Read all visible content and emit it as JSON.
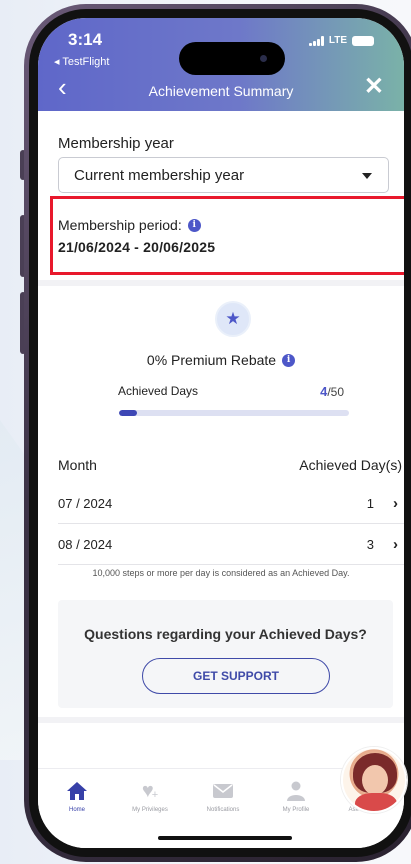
{
  "status_bar": {
    "time": "3:14",
    "back_app": "◂ TestFlight",
    "network": "LTE"
  },
  "nav": {
    "title": "Achievement Summary",
    "back": "‹",
    "close": "✕"
  },
  "membership": {
    "year_label": "Membership year",
    "year_selected": "Current membership year",
    "period_label": "Membership period:",
    "period_value": "21/06/2024 - 20/06/2025"
  },
  "rebate": {
    "title": "0% Premium Rebate",
    "achieved_label": "Achieved Days",
    "achieved_value": "4",
    "achieved_total": "/50",
    "progress_fraction": 0.08
  },
  "table": {
    "col_month": "Month",
    "col_days": "Achieved Day(s)",
    "rows": [
      {
        "month": "07 / 2024",
        "days": "1"
      },
      {
        "month": "08 / 2024",
        "days": "3"
      }
    ]
  },
  "footnote": "10,000 steps or more per day is considered as an Achieved Day.",
  "support": {
    "question": "Questions regarding your Achieved Days?",
    "button": "GET SUPPORT"
  },
  "tabs": [
    {
      "label": "Home",
      "icon": "home-icon",
      "active": true
    },
    {
      "label": "My Privileges",
      "icon": "heart-plus-icon",
      "active": false
    },
    {
      "label": "Notifications",
      "icon": "envelope-icon",
      "active": false
    },
    {
      "label": "My Profile",
      "icon": "person-icon",
      "active": false
    },
    {
      "label": "Ask Emma",
      "icon": "assistant-avatar-icon",
      "active": false
    }
  ],
  "colors": {
    "accent": "#4d57c8",
    "highlight_border": "#e8182c",
    "header_start": "#5f67c9",
    "header_end": "#7ab2a8"
  }
}
